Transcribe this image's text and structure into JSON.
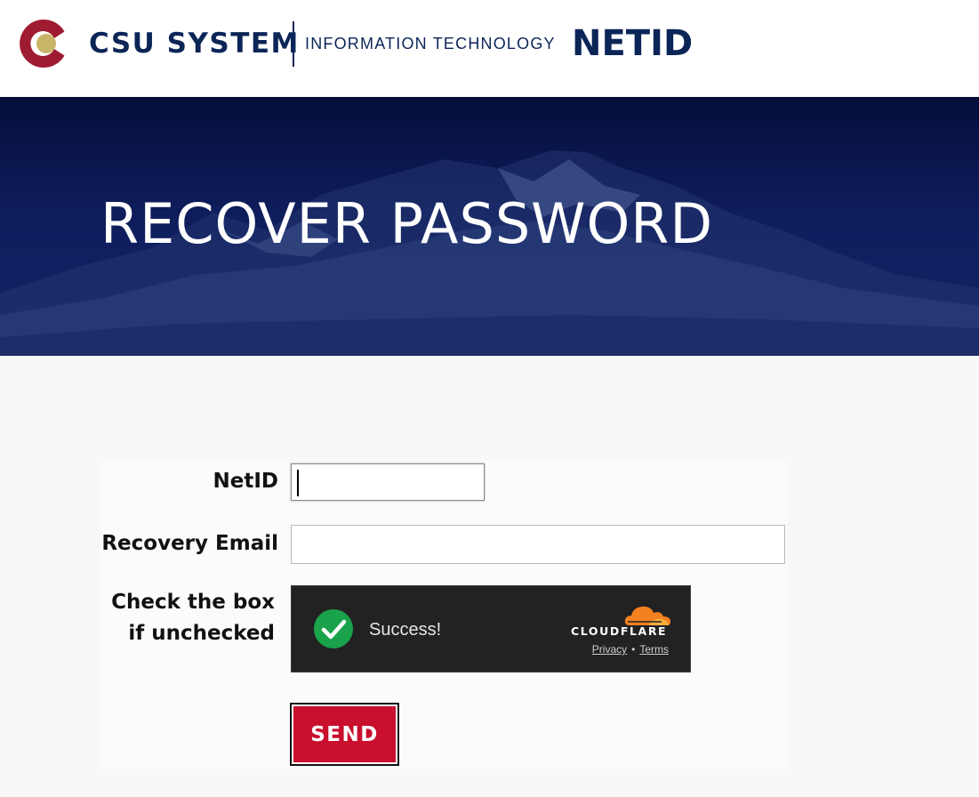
{
  "header": {
    "brand": "CSU SYSTEM",
    "department": "INFORMATION TECHNOLOGY",
    "app_name": "NETID"
  },
  "hero": {
    "title": "RECOVER PASSWORD"
  },
  "form": {
    "netid_label": "NetID",
    "netid_value": "",
    "email_label": "Recovery Email",
    "email_value": "",
    "captcha_label_line1": "Check the box",
    "captcha_label_line2": "if unchecked",
    "send_label": "SEND"
  },
  "captcha": {
    "status": "Success!",
    "provider": "CLOUDFLARE",
    "privacy_link": "Privacy",
    "separator": "•",
    "terms_link": "Terms"
  },
  "colors": {
    "navy": "#0c2557",
    "crimson": "#c8102e",
    "logo_maroon": "#9e1b32",
    "logo_gold": "#c8b568",
    "success_green": "#1aa34a",
    "cloudflare_orange": "#f48120"
  }
}
